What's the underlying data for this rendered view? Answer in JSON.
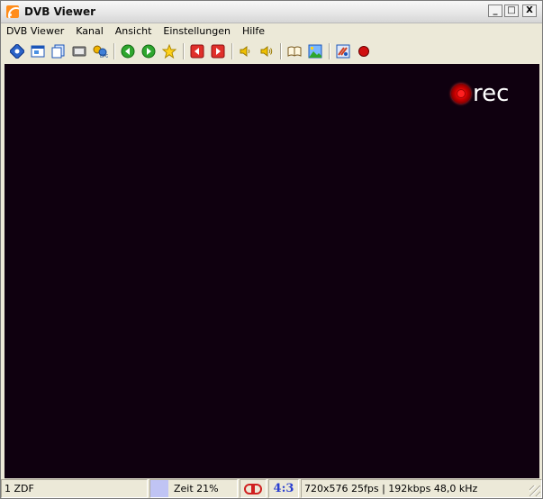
{
  "window": {
    "title": "DVB Viewer",
    "buttons": {
      "minimize": "_",
      "maximize": "□",
      "close": "X"
    }
  },
  "menu": [
    {
      "label": "DVB Viewer"
    },
    {
      "label": "Kanal"
    },
    {
      "label": "Ansicht"
    },
    {
      "label": "Einstellungen"
    },
    {
      "label": "Hilfe"
    }
  ],
  "toolbar": {
    "icons": [
      "osd-icon",
      "window-icon",
      "copy-window-icon",
      "tv-icon",
      "epg-icon",
      "back-icon",
      "forward-icon",
      "favorite-star-icon",
      "prev-channel-icon",
      "next-channel-icon",
      "volume-down-icon",
      "volume-up-icon",
      "teletext-book-icon",
      "picture-icon",
      "settings-icon",
      "record-icon"
    ]
  },
  "video": {
    "overlay": "rec"
  },
  "statusbar": {
    "channel": "1 ZDF",
    "time": "Zeit 21%",
    "aspect": "4:3",
    "info": "720x576 25fps | 192kbps 48,0 kHz"
  },
  "colors": {
    "video_bg": "#0f000f",
    "rec_red": "#d00000",
    "aspect_blue": "#2a3fd0",
    "time_swatch": "#c0c4f4"
  }
}
